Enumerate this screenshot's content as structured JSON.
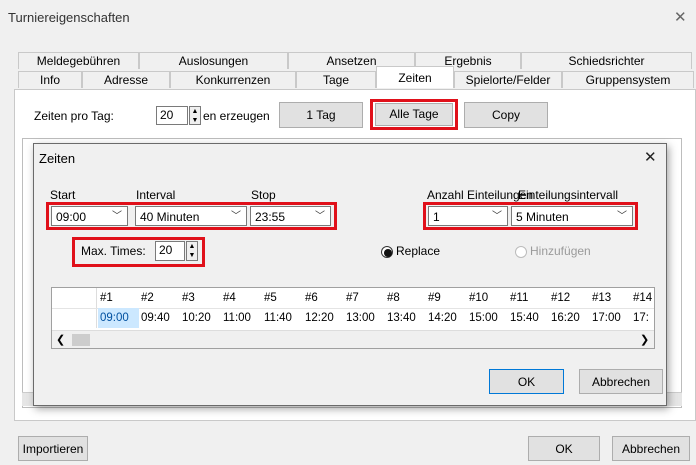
{
  "window": {
    "title": "Turniereigenschaften",
    "close": "✕"
  },
  "tabs_row1": [
    "Meldegebühren",
    "Auslosungen",
    "Ansetzen",
    "Ergebnis",
    "Schiedsrichter"
  ],
  "tabs_row2": [
    "Info",
    "Adresse",
    "Konkurrenzen",
    "Tage",
    "Zeiten",
    "Spielorte/Felder",
    "Gruppensystem"
  ],
  "active_tab": "Zeiten",
  "zeiten_tab": {
    "per_day_label": "Zeiten pro Tag:",
    "per_day_value": "20",
    "generate_label": "en erzeugen",
    "btn_1tag": "1 Tag",
    "btn_alle": "Alle Tage",
    "btn_copy": "Copy"
  },
  "outer_buttons": {
    "import": "Importieren",
    "ok": "OK",
    "cancel": "Abbrechen"
  },
  "dialog": {
    "title": "Zeiten",
    "close": "✕",
    "start_label": "Start",
    "interval_label": "Interval",
    "stop_label": "Stop",
    "start_value": "09:00",
    "interval_value": "40 Minuten",
    "stop_value": "23:55",
    "anzahl_label": "Anzahl Einteilungen",
    "einteil_label": "Einteilungsintervall",
    "anzahl_value": "1",
    "einteil_value": "5 Minuten",
    "maxtimes_label": "Max. Times:",
    "maxtimes_value": "20",
    "replace_label": "Replace",
    "hinzu_label": "Hinzufügen",
    "ok": "OK",
    "cancel": "Abbrechen",
    "grid_headers": [
      "#1",
      "#2",
      "#3",
      "#4",
      "#5",
      "#6",
      "#7",
      "#8",
      "#9",
      "#10",
      "#11",
      "#12",
      "#13",
      "#14"
    ],
    "grid_values": [
      "09:00",
      "09:40",
      "10:20",
      "11:00",
      "11:40",
      "12:20",
      "13:00",
      "13:40",
      "14:20",
      "15:00",
      "15:40",
      "16:20",
      "17:00",
      "17:"
    ]
  }
}
